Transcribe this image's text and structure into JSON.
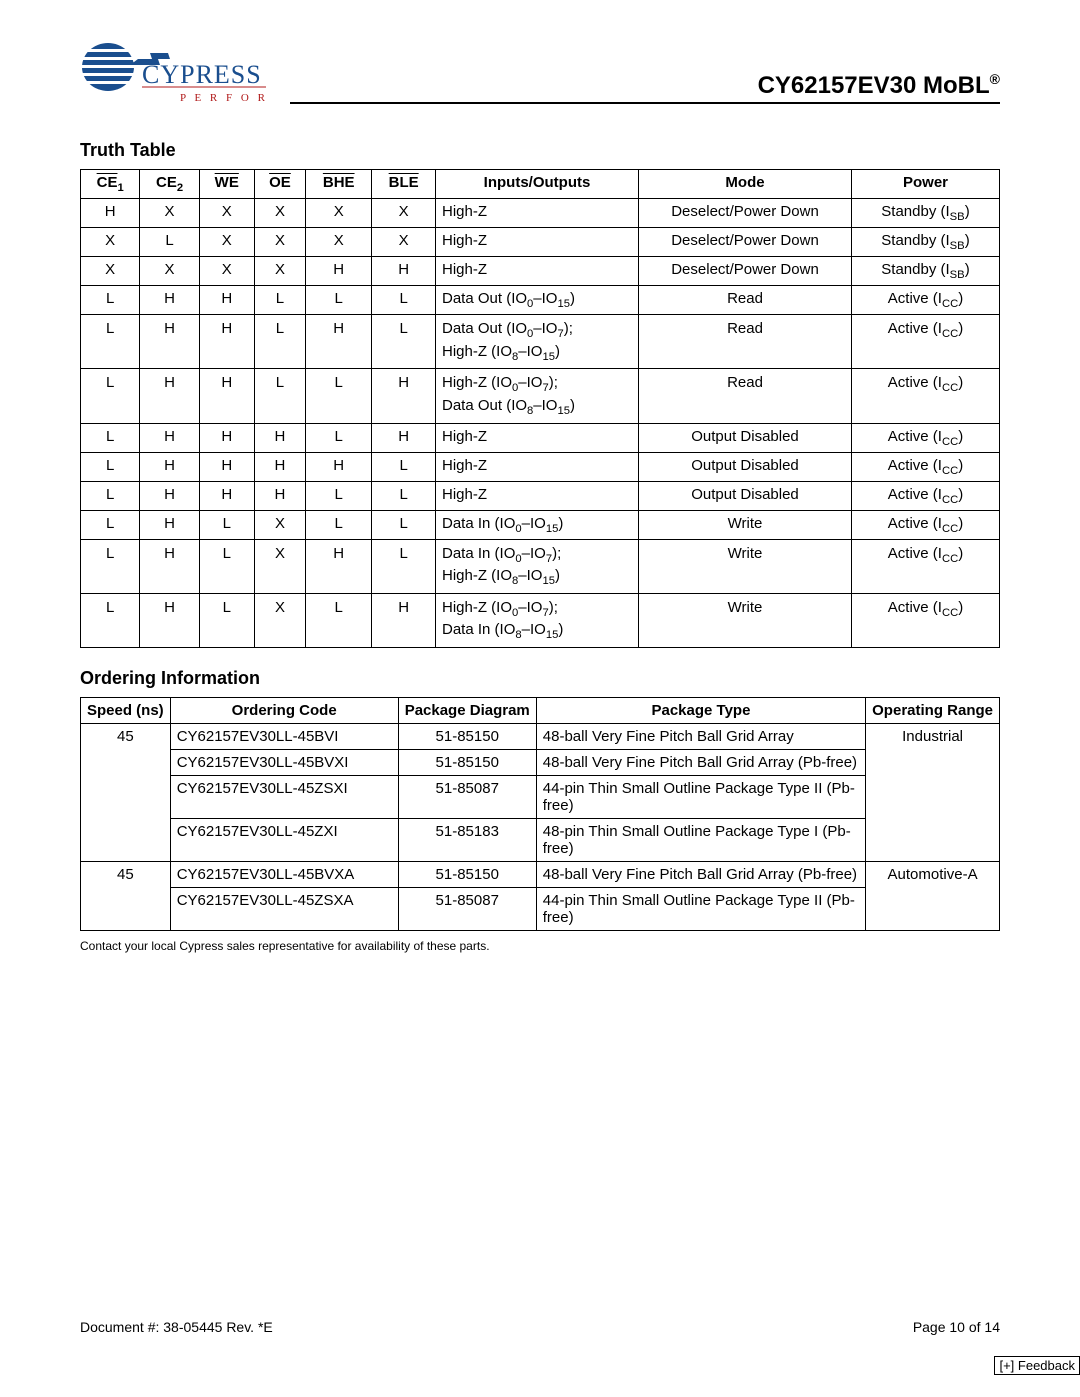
{
  "header": {
    "brand": "CYPRESS",
    "tagline": "P E R F O R M",
    "part": "CY62157EV30 MoBL",
    "reg": "®"
  },
  "truth": {
    "title": "Truth Table",
    "headers": {
      "ce1": "CE",
      "ce1_sub": "1",
      "ce2": "CE",
      "ce2_sub": "2",
      "we": "WE",
      "oe": "OE",
      "bhe": "BHE",
      "ble": "BLE",
      "io": "Inputs/Outputs",
      "mode": "Mode",
      "power": "Power"
    },
    "rows": [
      {
        "ce1": "H",
        "ce2": "X",
        "we": "X",
        "oe": "X",
        "bhe": "X",
        "ble": "X",
        "io": "High-Z",
        "mode": "Deselect/Power Down",
        "power": "Standby (I",
        "psub": "SB",
        "ptail": ")"
      },
      {
        "ce1": "X",
        "ce2": "L",
        "we": "X",
        "oe": "X",
        "bhe": "X",
        "ble": "X",
        "io": "High-Z",
        "mode": "Deselect/Power Down",
        "power": "Standby (I",
        "psub": "SB",
        "ptail": ")"
      },
      {
        "ce1": "X",
        "ce2": "X",
        "we": "X",
        "oe": "X",
        "bhe": "H",
        "ble": "H",
        "io": "High-Z",
        "mode": "Deselect/Power Down",
        "power": "Standby (I",
        "psub": "SB",
        "ptail": ")"
      },
      {
        "ce1": "L",
        "ce2": "H",
        "we": "H",
        "oe": "L",
        "bhe": "L",
        "ble": "L",
        "io": "Data Out (IO",
        "io_sub1": "0",
        "io_mid": "–IO",
        "io_sub2": "15",
        "io_tail": ")",
        "mode": "Read",
        "power": "Active (I",
        "psub": "CC",
        "ptail": ")"
      },
      {
        "ce1": "L",
        "ce2": "H",
        "we": "H",
        "oe": "L",
        "bhe": "H",
        "ble": "L",
        "io_l1a": "Data Out  (IO",
        "io_l1s1": "0",
        "io_l1b": "–IO",
        "io_l1s2": "7",
        "io_l1c": ");",
        "io_l2a": "High-Z (IO",
        "io_l2s1": "8",
        "io_l2b": "–IO",
        "io_l2s2": "15",
        "io_l2c": ")",
        "mode": "Read",
        "power": "Active (I",
        "psub": "CC",
        "ptail": ")",
        "two": true
      },
      {
        "ce1": "L",
        "ce2": "H",
        "we": "H",
        "oe": "L",
        "bhe": "L",
        "ble": "H",
        "io_l1a": "High-Z (IO",
        "io_l1s1": "0",
        "io_l1b": "–IO",
        "io_l1s2": "7",
        "io_l1c": ");",
        "io_l2a": "Data Out (IO",
        "io_l2s1": "8",
        "io_l2b": "–IO",
        "io_l2s2": "15",
        "io_l2c": ")",
        "mode": "Read",
        "power": "Active (I",
        "psub": "CC",
        "ptail": ")",
        "two": true
      },
      {
        "ce1": "L",
        "ce2": "H",
        "we": "H",
        "oe": "H",
        "bhe": "L",
        "ble": "H",
        "io": "High-Z",
        "mode": "Output Disabled",
        "power": "Active (I",
        "psub": "CC",
        "ptail": ")"
      },
      {
        "ce1": "L",
        "ce2": "H",
        "we": "H",
        "oe": "H",
        "bhe": "H",
        "ble": "L",
        "io": "High-Z",
        "mode": "Output Disabled",
        "power": "Active (I",
        "psub": "CC",
        "ptail": ")"
      },
      {
        "ce1": "L",
        "ce2": "H",
        "we": "H",
        "oe": "H",
        "bhe": "L",
        "ble": "L",
        "io": "High-Z",
        "mode": "Output Disabled",
        "power": "Active (I",
        "psub": "CC",
        "ptail": ")"
      },
      {
        "ce1": "L",
        "ce2": "H",
        "we": "L",
        "oe": "X",
        "bhe": "L",
        "ble": "L",
        "io": "Data In (IO",
        "io_sub1": "0",
        "io_mid": "–IO",
        "io_sub2": "15",
        "io_tail": ")",
        "mode": "Write",
        "power": "Active (I",
        "psub": "CC",
        "ptail": ")"
      },
      {
        "ce1": "L",
        "ce2": "H",
        "we": "L",
        "oe": "X",
        "bhe": "H",
        "ble": "L",
        "io_l1a": "Data In (IO",
        "io_l1s1": "0",
        "io_l1b": "–IO",
        "io_l1s2": "7",
        "io_l1c": ");",
        "io_l2a": "High-Z (IO",
        "io_l2s1": "8",
        "io_l2b": "–IO",
        "io_l2s2": "15",
        "io_l2c": ")",
        "mode": "Write",
        "power": "Active (I",
        "psub": "CC",
        "ptail": ")",
        "two": true
      },
      {
        "ce1": "L",
        "ce2": "H",
        "we": "L",
        "oe": "X",
        "bhe": "L",
        "ble": "H",
        "io_l1a": "High-Z (IO",
        "io_l1s1": "0",
        "io_l1b": "–IO",
        "io_l1s2": "7",
        "io_l1c": ");",
        "io_l2a": "Data In (IO",
        "io_l2s1": "8",
        "io_l2b": "–IO",
        "io_l2s2": "15",
        "io_l2c": ")",
        "mode": "Write",
        "power": "Active (I",
        "psub": "CC",
        "ptail": ")",
        "two": true
      }
    ]
  },
  "ordering": {
    "title": "Ordering Information",
    "headers": {
      "speed": "Speed (ns)",
      "code": "Ordering Code",
      "diag": "Package Diagram",
      "type": "Package Type",
      "range": "Operating Range"
    },
    "groups": [
      {
        "speed": "45",
        "range": "Industrial",
        "rows": [
          {
            "code": "CY62157EV30LL-45BVI",
            "diag": "51-85150",
            "type": "48-ball Very Fine Pitch Ball Grid Array"
          },
          {
            "code": "CY62157EV30LL-45BVXI",
            "diag": "51-85150",
            "type": "48-ball Very Fine Pitch Ball Grid Array (Pb-free)"
          },
          {
            "code": "CY62157EV30LL-45ZSXI",
            "diag": "51-85087",
            "type": "44-pin Thin Small Outline Package Type II (Pb-free)"
          },
          {
            "code": "CY62157EV30LL-45ZXI",
            "diag": "51-85183",
            "type": "48-pin Thin Small Outline Package Type I (Pb-free)"
          }
        ]
      },
      {
        "speed": "45",
        "range": "Automotive-A",
        "rows": [
          {
            "code": "CY62157EV30LL-45BVXA",
            "diag": "51-85150",
            "type": "48-ball Very Fine Pitch Ball Grid Array (Pb-free)"
          },
          {
            "code": "CY62157EV30LL-45ZSXA",
            "diag": "51-85087",
            "type": "44-pin Thin Small Outline Package Type II (Pb-free)"
          }
        ]
      }
    ],
    "footnote": "Contact your local Cypress sales representative for availability of these parts."
  },
  "footer": {
    "doc": "Document #: 38-05445 Rev. *E",
    "page": "Page 10 of 14",
    "feedback": "[+] Feedback"
  }
}
